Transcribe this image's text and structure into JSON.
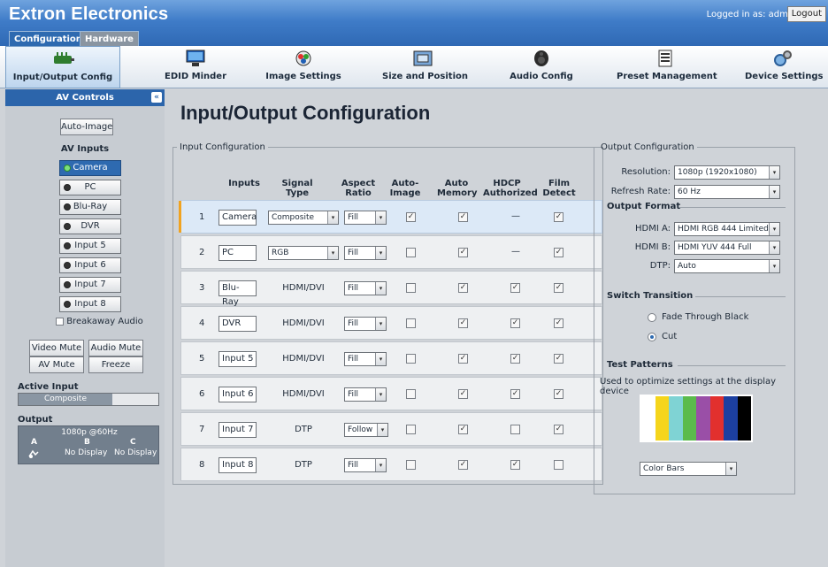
{
  "header": {
    "brand": "Extron Electronics",
    "login_text": "Logged in as: admin",
    "logout": "Logout",
    "tabs": [
      {
        "label": "Configuration"
      },
      {
        "label": "Hardware"
      }
    ]
  },
  "toolbar": {
    "items": [
      {
        "label": "Input/Output Config",
        "icon": "io-config-icon",
        "active": true
      },
      {
        "label": "EDID Minder",
        "icon": "monitor-icon"
      },
      {
        "label": "Image Settings",
        "icon": "color-wheel-icon"
      },
      {
        "label": "Size and Position",
        "icon": "resize-frame-icon"
      },
      {
        "label": "Audio Config",
        "icon": "speaker-icon"
      },
      {
        "label": "Preset Management",
        "icon": "preset-folder-icon"
      },
      {
        "label": "Device Settings",
        "icon": "gears-icon"
      }
    ]
  },
  "left": {
    "header": "AV Controls",
    "collapse": "«",
    "auto_image": "Auto-Image",
    "av_inputs_title": "AV Inputs",
    "inputs": [
      {
        "label": "Camera",
        "active": true
      },
      {
        "label": "PC"
      },
      {
        "label": "Blu-Ray"
      },
      {
        "label": "DVR"
      },
      {
        "label": "Input 5"
      },
      {
        "label": "Input 6"
      },
      {
        "label": "Input 7"
      },
      {
        "label": "Input 8"
      }
    ],
    "breakaway": "Breakaway Audio",
    "video_mute": "Video Mute",
    "audio_mute": "Audio Mute",
    "av_mute": "AV Mute",
    "freeze": "Freeze",
    "active_input_title": "Active Input",
    "active_input_value": "Composite",
    "output_title": "Output",
    "output_res": "1080p @60Hz",
    "output_cols": [
      "A",
      "B",
      "C"
    ],
    "output_b": "No Display",
    "output_c": "No Display"
  },
  "main": {
    "title": "Input/Output Configuration",
    "input_config_legend": "Input Configuration",
    "columns": {
      "inputs": "Inputs",
      "signal_type": "Signal Type",
      "aspect_ratio": "Aspect Ratio",
      "auto_image": "Auto- Image",
      "auto_memory": "Auto Memory",
      "hdcp": "HDCP Authorized",
      "film_detect": "Film Detect"
    },
    "rows": [
      {
        "num": "1",
        "name": "Camera",
        "signal": "Composite",
        "signal_select": true,
        "aspect": "Fill",
        "auto_image": true,
        "auto_memory": true,
        "hdcp": "—",
        "film": true
      },
      {
        "num": "2",
        "name": "PC",
        "signal": "RGB",
        "signal_select": true,
        "aspect": "Fill",
        "auto_image": false,
        "auto_memory": true,
        "hdcp": "—",
        "film": true
      },
      {
        "num": "3",
        "name": "Blu-Ray",
        "signal": "HDMI/DVI",
        "aspect": "Fill",
        "auto_image": false,
        "auto_memory": true,
        "hdcp": true,
        "film": true
      },
      {
        "num": "4",
        "name": "DVR",
        "signal": "HDMI/DVI",
        "aspect": "Fill",
        "auto_image": false,
        "auto_memory": true,
        "hdcp": true,
        "film": true
      },
      {
        "num": "5",
        "name": "Input 5",
        "signal": "HDMI/DVI",
        "aspect": "Fill",
        "auto_image": false,
        "auto_memory": true,
        "hdcp": true,
        "film": true
      },
      {
        "num": "6",
        "name": "Input 6",
        "signal": "HDMI/DVI",
        "aspect": "Fill",
        "auto_image": false,
        "auto_memory": true,
        "hdcp": true,
        "film": true
      },
      {
        "num": "7",
        "name": "Input 7",
        "signal": "DTP",
        "aspect": "Follow",
        "auto_image": false,
        "auto_memory": true,
        "hdcp": false,
        "film": true
      },
      {
        "num": "8",
        "name": "Input 8",
        "signal": "DTP",
        "aspect": "Fill",
        "auto_image": false,
        "auto_memory": true,
        "hdcp": true,
        "film": false
      }
    ],
    "output": {
      "legend": "Output Configuration",
      "resolution_label": "Resolution:",
      "resolution": "1080p (1920x1080)",
      "refresh_label": "Refresh Rate:",
      "refresh": "60 Hz",
      "format_title": "Output Format",
      "hdmi_a_label": "HDMI A:",
      "hdmi_a": "HDMI RGB 444 Limited",
      "hdmi_b_label": "HDMI B:",
      "hdmi_b": "HDMI YUV 444 Full",
      "dtp_label": "DTP:",
      "dtp": "Auto",
      "switch_title": "Switch Transition",
      "fade": "Fade Through Black",
      "cut": "Cut",
      "selected_transition": "Cut",
      "test_title": "Test Patterns",
      "test_desc": "Used to optimize settings at the display device",
      "pattern": "Color Bars",
      "bar_colors": [
        "#ffffff",
        "#f5d51c",
        "#7fd3d4",
        "#5bbb4c",
        "#9a4fa7",
        "#e2302e",
        "#1c3fa0",
        "#000000"
      ]
    }
  }
}
